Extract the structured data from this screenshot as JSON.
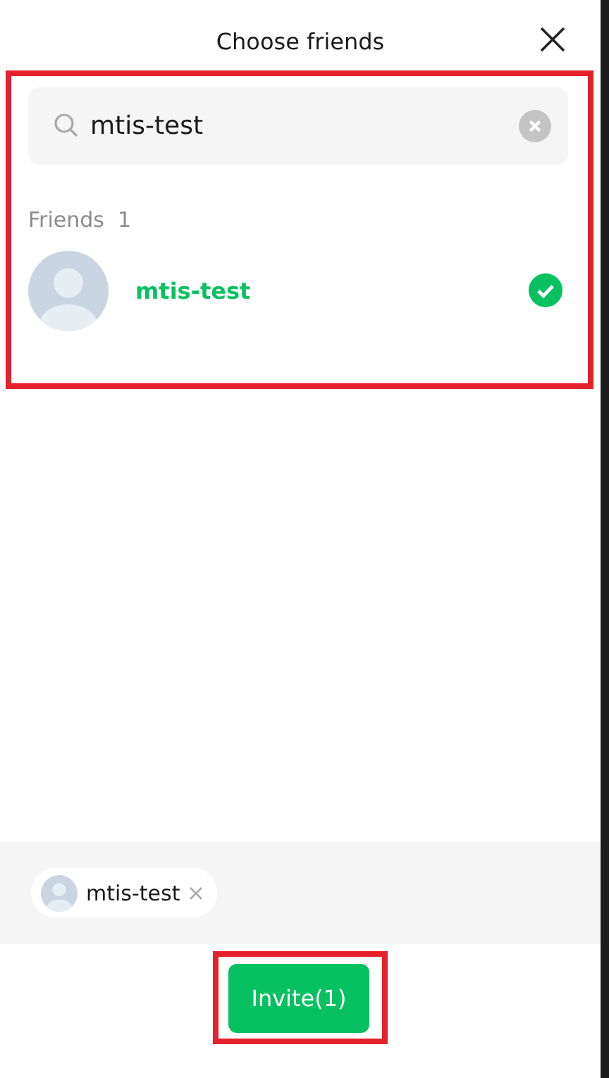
{
  "dialog": {
    "title": "Choose friends"
  },
  "search": {
    "value": "mtis-test"
  },
  "section": {
    "label": "Friends",
    "count": "1"
  },
  "friends": [
    {
      "name": "mtis-test",
      "selected": true
    }
  ],
  "chips": [
    {
      "name": "mtis-test"
    }
  ],
  "invite_button": {
    "label": "Invite(1)"
  }
}
